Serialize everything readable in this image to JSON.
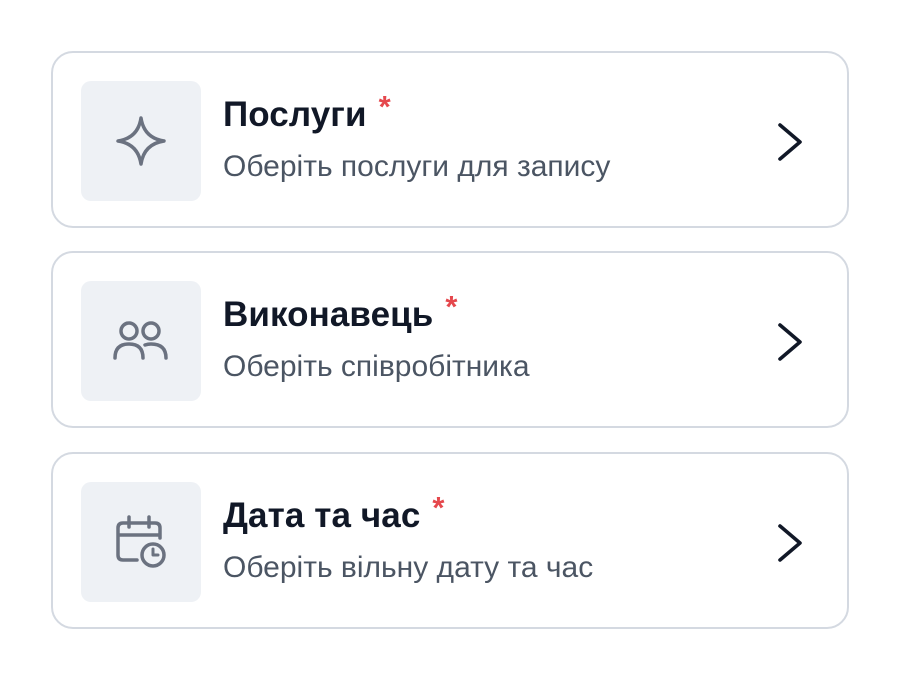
{
  "booking_steps": [
    {
      "title": "Послуги",
      "required_mark": "*",
      "subtitle": "Оберіть послуги для запису",
      "icon": "sparkle-icon"
    },
    {
      "title": "Виконавець",
      "required_mark": "*",
      "subtitle": "Оберіть співробітника",
      "icon": "users-icon"
    },
    {
      "title": "Дата та час",
      "required_mark": "*",
      "subtitle": "Оберіть вільну дату та час",
      "icon": "calendar-clock-icon"
    }
  ],
  "colors": {
    "title": "#111827",
    "subtitle": "#4b5563",
    "required": "#e5484d",
    "icon": "#6b7280",
    "icon_background": "#eef1f5",
    "card_border": "#d4d9e1"
  }
}
